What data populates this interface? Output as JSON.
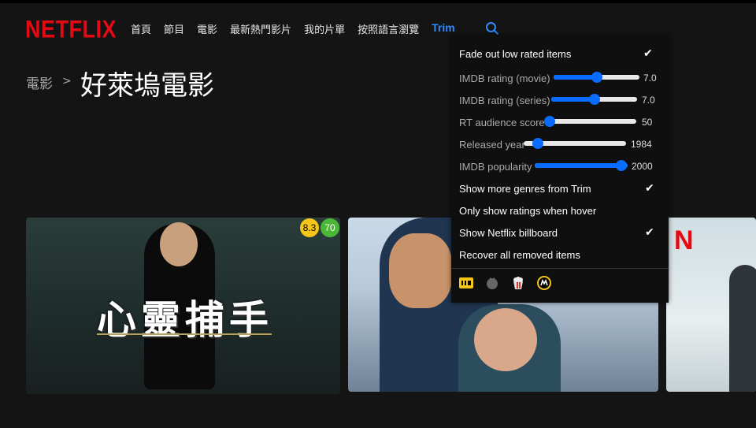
{
  "brand": {
    "logo": "NETFLIX",
    "logo_color": "#e50914"
  },
  "nav": {
    "items": [
      "首頁",
      "節目",
      "電影",
      "最新熱門影片",
      "我的片單",
      "按照語言瀏覽"
    ],
    "trim": "Trim",
    "search_icon": "search-icon"
  },
  "breadcrumb": {
    "parent": "電影",
    "separator": ">",
    "title": "好萊塢電影"
  },
  "cards": [
    {
      "title": "心靈捕手",
      "imdb": "8.3",
      "rt": "70"
    },
    {
      "title": ""
    },
    {
      "logo": "N"
    }
  ],
  "trim_menu": {
    "fade_label": "Fade out low rated items",
    "sliders": [
      {
        "label": "IMDB rating (movie)",
        "value": "7.0",
        "fraction": 0.5
      },
      {
        "label": "IMDB rating (series)",
        "value": "7.0",
        "fraction": 0.5
      },
      {
        "label": "RT audience score",
        "value": "50",
        "fraction": 0.0
      },
      {
        "label": "Released year",
        "value": "1984",
        "fraction": 0.0
      },
      {
        "label": "IMDB popularity",
        "value": "2000",
        "fraction": 1.0
      }
    ],
    "options": [
      {
        "label": "Show more genres from Trim",
        "checked": true
      },
      {
        "label": "Only show ratings when hover",
        "checked": false
      },
      {
        "label": "Show Netflix billboard",
        "checked": true
      },
      {
        "label": "Recover all removed items",
        "checked": false
      }
    ],
    "footer_icons": [
      "imdb-icon",
      "tomato-icon",
      "popcorn-icon",
      "metacritic-icon"
    ]
  },
  "colors": {
    "accent": "#0a6cff",
    "imdb_badge": "#f5c518",
    "rt_badge": "#4ab737",
    "trim_link": "#2f8cff"
  }
}
